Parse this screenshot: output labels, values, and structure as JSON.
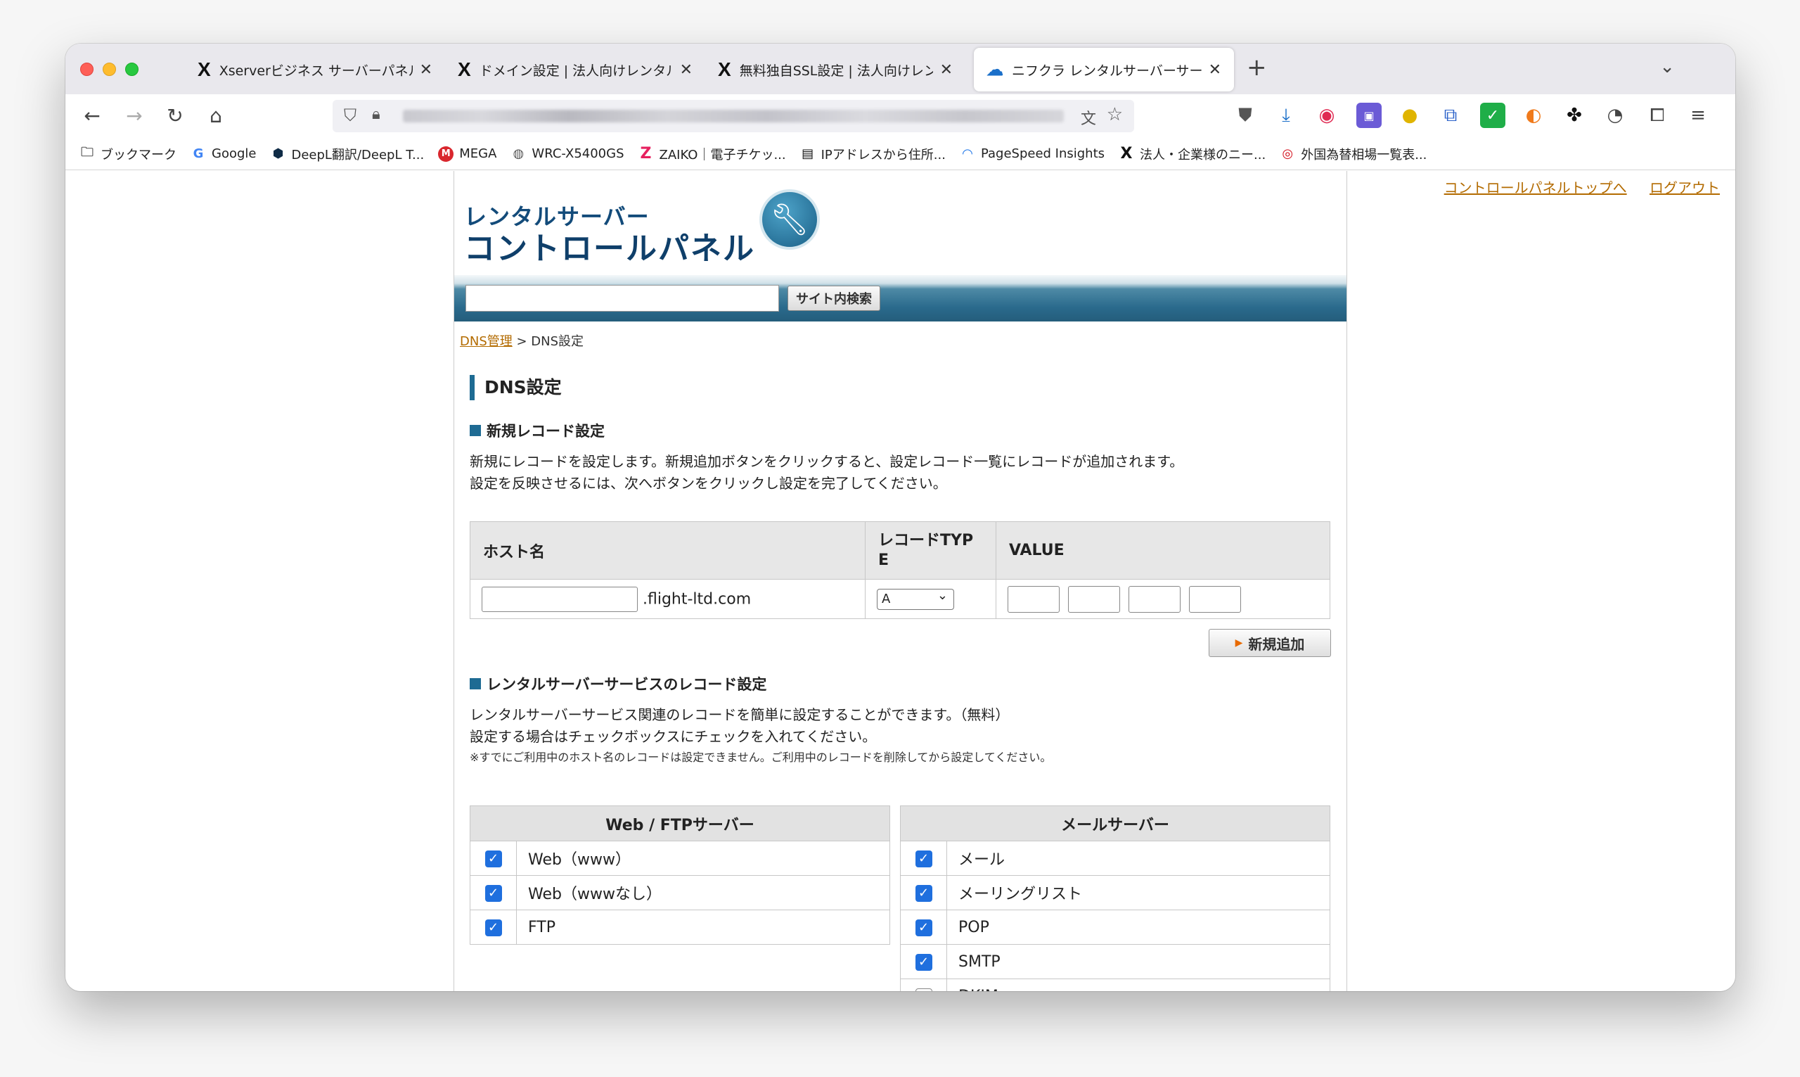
{
  "browser": {
    "tabs": [
      {
        "icon": "X",
        "title": "Xserverビジネス サーバーパネル",
        "active": false
      },
      {
        "icon": "X",
        "title": "ドメイン設定 | 法人向けレンタル",
        "active": false
      },
      {
        "icon": "X",
        "title": "無料独自SSL設定 | 法人向けレン",
        "active": false
      },
      {
        "icon": "cloud",
        "title": "ニフクラ レンタルサーバーサービ",
        "active": true
      }
    ],
    "new_tab": "+",
    "bookmarks": [
      {
        "icon": "folder-icon",
        "label": "ブックマーク"
      },
      {
        "icon": "google-icon",
        "label": "Google"
      },
      {
        "icon": "deepl-icon",
        "label": "DeepL翻訳/DeepL T..."
      },
      {
        "icon": "mega-icon",
        "label": "MEGA"
      },
      {
        "icon": "globe-icon",
        "label": "WRC-X5400GS"
      },
      {
        "icon": "zaiko-icon",
        "label": "ZAIKO｜電子チケッ..."
      },
      {
        "icon": "ip-icon",
        "label": "IPアドレスから住所..."
      },
      {
        "icon": "pagespeed-icon",
        "label": "PageSpeed Insights"
      },
      {
        "icon": "x-icon",
        "label": "法人・企業様のニー..."
      },
      {
        "icon": "mufg-icon",
        "label": "外国為替相場一覧表..."
      }
    ]
  },
  "page": {
    "top_links": [
      "コントロールパネルトップへ",
      "ログアウト"
    ],
    "logo": {
      "line1": "レンタルサーバー",
      "line2": "コントロールパネル"
    },
    "search": {
      "button": "サイト内検索",
      "value": ""
    },
    "breadcrumb": {
      "link": "DNS管理",
      "separator": " > ",
      "current": "DNS設定"
    },
    "title": "DNS設定",
    "new_record": {
      "heading": "新規レコード設定",
      "desc_line1": "新規にレコードを設定します。新規追加ボタンをクリックすると、設定レコード一覧にレコードが追加されます。",
      "desc_line2": "設定を反映させるには、次へボタンをクリックし設定を完了してください。",
      "col_host": "ホスト名",
      "col_type_1": "レコードTYP",
      "col_type_2": "E",
      "col_value": "VALUE",
      "domain_suffix": ".flight-ltd.com",
      "type_selected": "A",
      "add_button": "新規追加"
    },
    "service_record": {
      "heading": "レンタルサーバーサービスのレコード設定",
      "desc_line1": "レンタルサーバーサービス関連のレコードを簡単に設定することができます。（無料）",
      "desc_line2": "設定する場合はチェックボックスにチェックを入れてください。",
      "note": "※すでにご利用中のホスト名のレコードは設定できません。ご利用中のレコードを削除してから設定してください。",
      "web_header": "Web / FTPサーバー",
      "web_items": [
        {
          "label": "Web（www）",
          "checked": true
        },
        {
          "label": "Web（wwwなし）",
          "checked": true
        },
        {
          "label": "FTP",
          "checked": true
        }
      ],
      "mail_header": "メールサーバー",
      "mail_items": [
        {
          "label": "メール",
          "checked": true
        },
        {
          "label": "メーリングリスト",
          "checked": true
        },
        {
          "label": "POP",
          "checked": true
        },
        {
          "label": "SMTP",
          "checked": true
        },
        {
          "label": "DKIM",
          "checked": false
        }
      ]
    }
  }
}
